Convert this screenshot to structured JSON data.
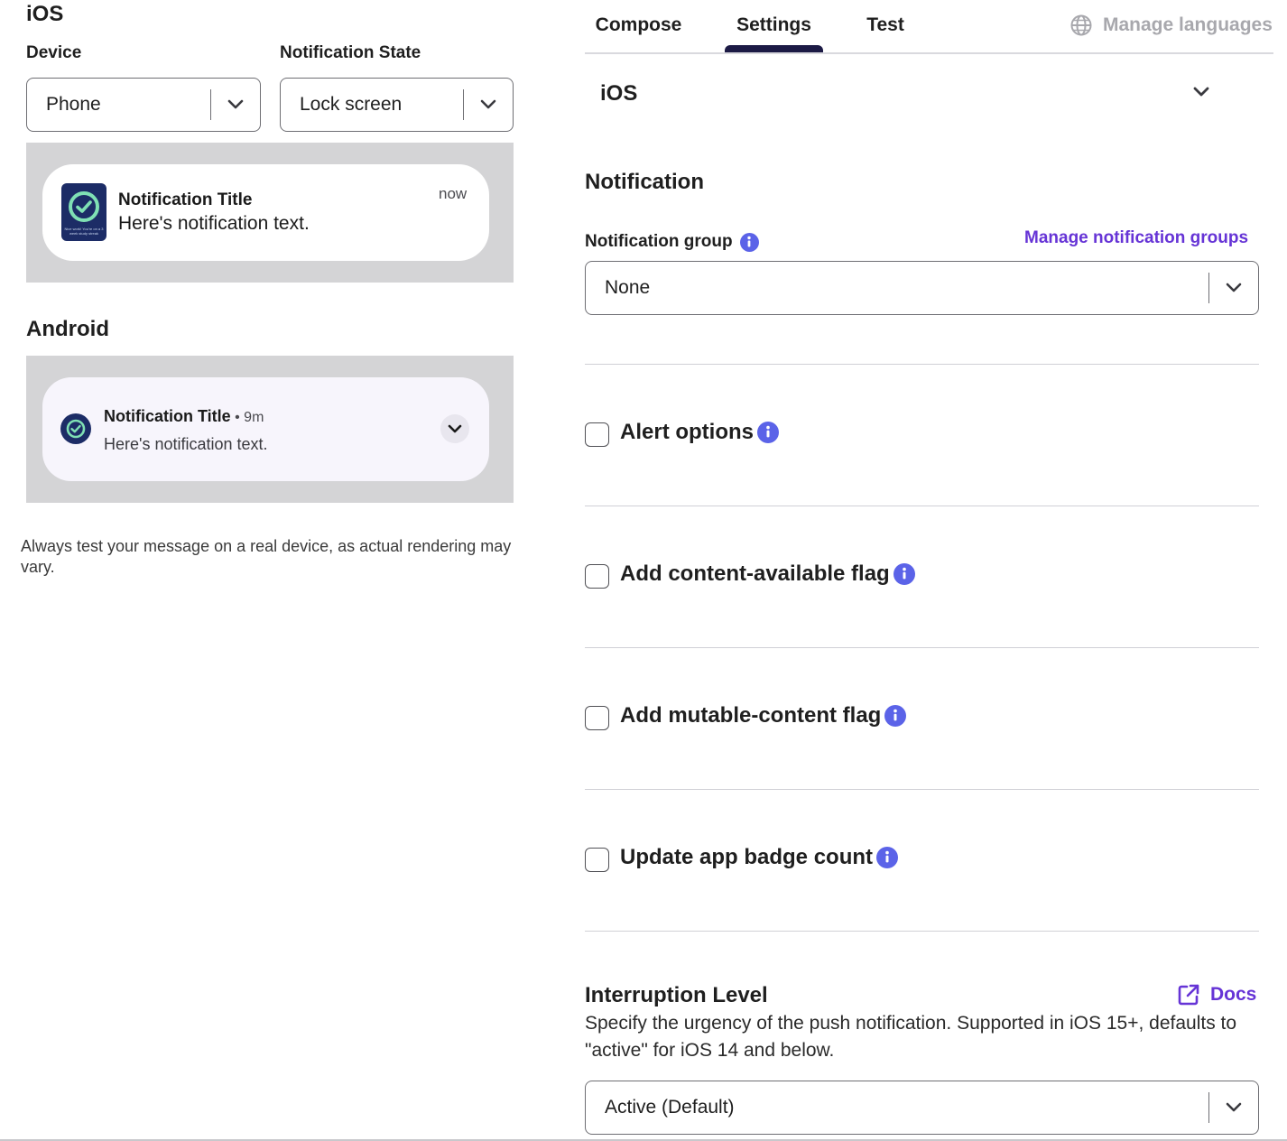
{
  "preview": {
    "ios_heading": "iOS",
    "device_label": "Device",
    "device_value": "Phone",
    "state_label": "Notification State",
    "state_value": "Lock screen",
    "ios_notification": {
      "title": "Notification Title",
      "body": "Here's notification text.",
      "time": "now",
      "icon_fine_print": "Nice work! You're on a 3 week study streak"
    },
    "android_heading": "Android",
    "android_notification": {
      "title": "Notification Title",
      "time": "• 9m",
      "body": "Here's notification text."
    },
    "disclaimer": "Always test your message on a real device, as actual rendering may vary."
  },
  "tabs": [
    {
      "label": "Compose"
    },
    {
      "label": "Settings",
      "active": true
    },
    {
      "label": "Test"
    }
  ],
  "manage_languages": "Manage languages",
  "platform_section": {
    "title": "iOS"
  },
  "notification_section": {
    "heading": "Notification",
    "group_label": "Notification group",
    "manage_groups_link": "Manage notification groups",
    "group_value": "None"
  },
  "options": [
    {
      "label": "Alert options",
      "checked": false
    },
    {
      "label": "Add content-available flag",
      "checked": false
    },
    {
      "label": "Add mutable-content flag",
      "checked": false
    },
    {
      "label": "Update app badge count",
      "checked": false
    }
  ],
  "interruption": {
    "heading": "Interruption Level",
    "docs_link": "Docs",
    "description": "Specify the urgency of the push notification. Supported in iOS 15+, defaults to \"active\" for iOS 14 and below.",
    "value": "Active (Default)"
  },
  "colors": {
    "accent_link": "#6634d6",
    "info_icon": "#5b63e8",
    "tab_indicator": "#1c1a45",
    "app_icon_bg": "#1c2c66",
    "app_icon_ring": "#7fe0b4",
    "preview_bg": "#d4d4d6"
  }
}
